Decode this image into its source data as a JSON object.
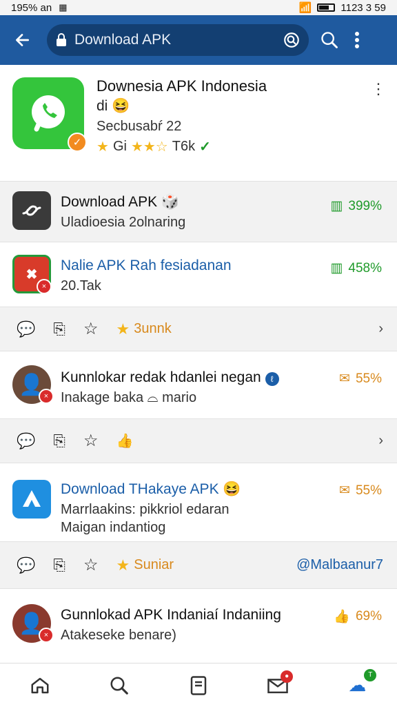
{
  "status": {
    "left": "195% an",
    "carrier_icon": "sim-icon",
    "right_time": "1123 3 59"
  },
  "toolbar": {
    "search_value": "Download APK"
  },
  "app": {
    "title": "Downesia APK Indonesia",
    "subtitle1": "di 😆",
    "subtitle2": "Secbusabŕ 22",
    "rating_text": "Gi",
    "rating_count": "T6k"
  },
  "items": [
    {
      "title": "Download APK 🎲",
      "subtitle": "Uladioesia 2olnaring",
      "metric": "399%"
    },
    {
      "title": "Nalie APK Rah fesiadanan",
      "subtitle": "20.Tak",
      "metric": "458%"
    },
    {
      "title": "Kunnlokar redak hdanlei negan",
      "subtitle": "Inakage baka",
      "subtitle_handle": "mario",
      "metric": "55%"
    },
    {
      "title": "Download THakaye APK 😆",
      "subtitle": "Marrlaakins: pikkriol edaran",
      "subtitle2": "Maigan indantiog",
      "metric": "55%"
    },
    {
      "title": "Gunnlokad APK Indaniaí Indaniing",
      "subtitle": "Atakeseke benare)",
      "metric": "69%"
    }
  ],
  "actions": [
    {
      "label": "3unnk"
    },
    {
      "label": ""
    },
    {
      "label": "Suniar",
      "right": "@Malbaanur7"
    }
  ],
  "colors": {
    "topbar": "#1f5a9f",
    "search_bg": "#133f72",
    "accent_green": "#1f9a2a",
    "accent_orange": "#d8891c"
  }
}
